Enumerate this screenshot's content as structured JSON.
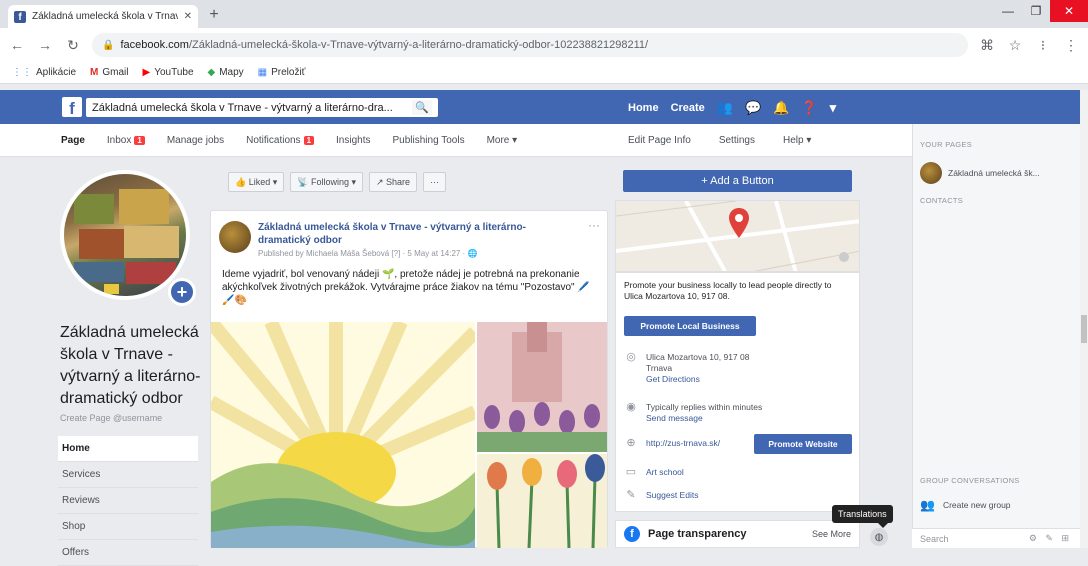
{
  "browser": {
    "tab_title": "Základná umelecká škola v Trnav",
    "url_domain": "facebook.com",
    "url_rest": "/Základná-umelecká-škola-v-Trnave-výtvarný-a-literárno-dramatický-odbor-102238821298211/",
    "bookmarks": [
      {
        "label": "Aplikácie",
        "icon": "apps-icon"
      },
      {
        "label": "Gmail",
        "icon": "gmail-icon"
      },
      {
        "label": "YouTube",
        "icon": "youtube-icon"
      },
      {
        "label": "Mapy",
        "icon": "maps-icon"
      },
      {
        "label": "Preložiť",
        "icon": "translate-icon"
      }
    ]
  },
  "fb": {
    "search_value": "Základná umelecká škola v Trnave - výtvarný a literárno-dra...",
    "nav_home": "Home",
    "nav_create": "Create"
  },
  "page_tabs": {
    "left": [
      {
        "label": "Page",
        "badge": ""
      },
      {
        "label": "Inbox",
        "badge": "1"
      },
      {
        "label": "Manage jobs",
        "badge": ""
      },
      {
        "label": "Notifications",
        "badge": "1"
      },
      {
        "label": "Insights",
        "badge": ""
      },
      {
        "label": "Publishing Tools",
        "badge": ""
      },
      {
        "label": "More ▾",
        "badge": ""
      }
    ],
    "right": [
      "Edit Page Info",
      "Settings",
      "Help ▾"
    ]
  },
  "profile": {
    "name": "Základná umelecká škola v Trnave - výtvarný a literárno-dramatický odbor",
    "username_hint": "Create Page @username",
    "side_nav": [
      "Home",
      "Services",
      "Reviews",
      "Shop",
      "Offers"
    ]
  },
  "actions": {
    "liked": "👍 Liked ▾",
    "following": "📡 Following ▾",
    "share": "↗ Share",
    "more": "···",
    "add_button": "+ Add a Button"
  },
  "post": {
    "title": "Základná umelecká škola v Trnave - výtvarný a literárno-dramatický odbor",
    "meta": "Published by Michaela Máša Šebová [?] · 5 May at 14:27 · 🌐",
    "text": "Ideme vyjadriť, bol venovaný nádeji 🌱, pretože nádej je potrebná na prekonanie akýchkoľvek životných prekážok. Vytvárajme práce žiakov na tému \"Pozostavo\" 🖊️🖌️🎨",
    "more": "···"
  },
  "info": {
    "promote_text": "Promote your business locally to lead people directly to Ulica Mozartova 10, 917 08.",
    "promote_local": "Promote Local Business",
    "address_line1": "Ulica Mozartova 10, 917 08",
    "address_line2": "Trnava",
    "get_directions": "Get Directions",
    "reply_line1": "Typically replies within minutes",
    "reply_line2": "Send message",
    "website": "http://zus-trnava.sk/",
    "promote_website": "Promote Website",
    "category": "Art school",
    "suggest": "Suggest Edits"
  },
  "transparency": {
    "title": "Page transparency",
    "see_more": "See More",
    "tooltip": "Translations"
  },
  "right_col": {
    "your_pages": "YOUR PAGES",
    "page_name": "Základná umelecká šk...",
    "contacts": "CONTACTS",
    "group_conv": "GROUP CONVERSATIONS",
    "create_group": "Create new group",
    "search_placeholder": "Search"
  },
  "colors": {
    "fb_blue": "#4267b2",
    "link_blue": "#385898",
    "badge_red": "#fa3e3e",
    "pin_red": "#e0413b"
  }
}
